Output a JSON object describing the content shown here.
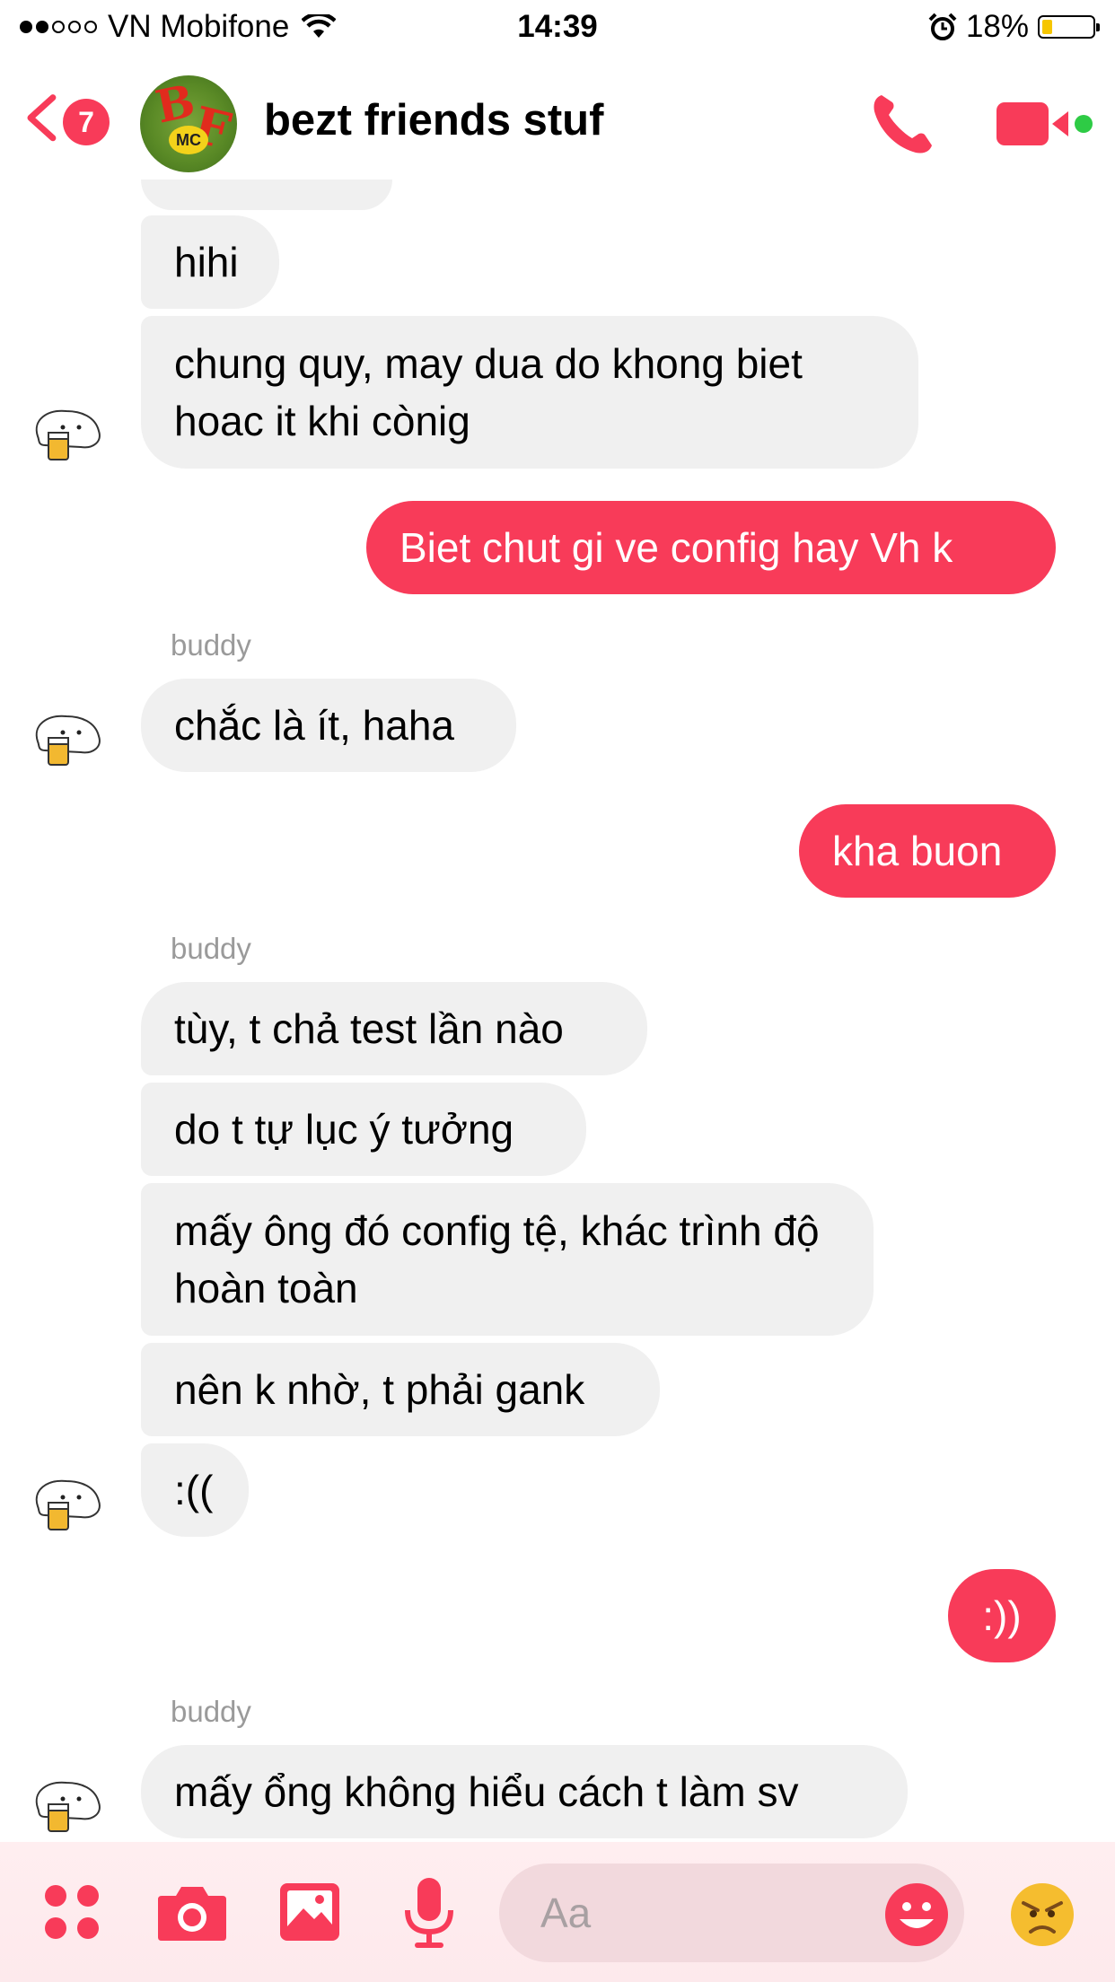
{
  "status_bar": {
    "carrier": "VN Mobifone",
    "time": "14:39",
    "battery_pct": "18%",
    "signal_bars": 2,
    "battery_level": 0.18
  },
  "header": {
    "unread_count": "7",
    "chat_title": "bezt friends stuf",
    "avatar_text": "BF",
    "avatar_small": "MC",
    "accent_color": "#f83b59",
    "online_color": "#2ecb45"
  },
  "messages": [
    {
      "from": "in",
      "text": "hihi"
    },
    {
      "from": "in",
      "text": "chung quy, may dua do khong biet hoac it khi cònig"
    },
    {
      "from": "out",
      "text": "Biet chut gi ve config hay Vh k"
    },
    {
      "sender": "buddy",
      "from": "in",
      "text": "chắc là ít, haha"
    },
    {
      "from": "out",
      "text": "kha buon"
    },
    {
      "sender": "buddy",
      "from": "in",
      "text": "tùy, t chả test lần nào"
    },
    {
      "from": "in",
      "text": "do t tự lục ý tưởng"
    },
    {
      "from": "in",
      "text": "mấy ông đó config tệ, khác trình độ hoàn toàn"
    },
    {
      "from": "in",
      "text": "nên k nhờ, t phải gank"
    },
    {
      "from": "in",
      "text": ":(("
    },
    {
      "from": "out",
      "text": ":))"
    },
    {
      "sender": "buddy",
      "from": "in",
      "text": "mấy ổng không hiểu cách t làm sv"
    }
  ],
  "sender_labels": [
    "buddy",
    "buddy",
    "buddy"
  ],
  "composer": {
    "placeholder": "Aa",
    "icons": [
      "apps-icon",
      "camera-icon",
      "gallery-icon",
      "mic-icon",
      "emoji-icon",
      "angry-emoji-icon"
    ]
  }
}
